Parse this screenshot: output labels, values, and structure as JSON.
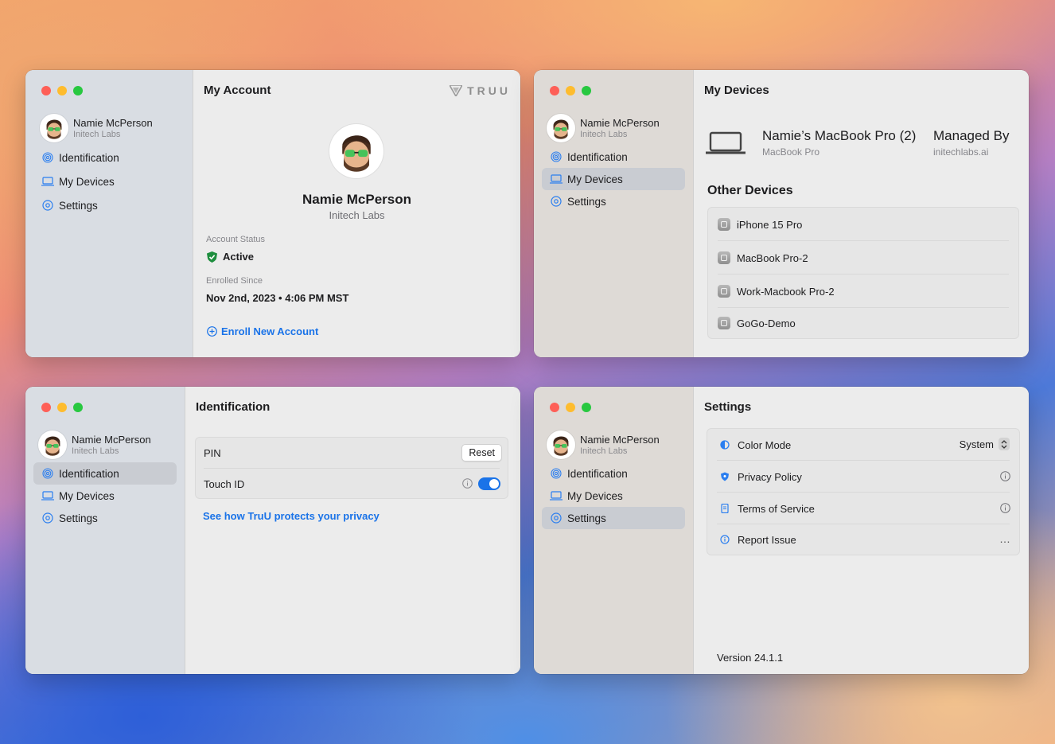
{
  "user": {
    "name": "Namie McPerson",
    "org": "Initech Labs"
  },
  "nav": {
    "identification": "Identification",
    "devices": "My Devices",
    "settings": "Settings"
  },
  "account": {
    "title": "My Account",
    "logo": "TRUU",
    "status_label": "Account Status",
    "status_value": "Active",
    "enrolled_label": "Enrolled Since",
    "enrolled_value": "Nov 2nd, 2023 • 4:06 PM MST",
    "enroll_link": "Enroll New Account"
  },
  "devices": {
    "title": "My Devices",
    "current_name": "Namie’s MacBook Pro (2)",
    "current_model": "MacBook Pro",
    "managed_label": "Managed By",
    "managed_value": "initechlabs.ai",
    "other_title": "Other Devices",
    "other": [
      "iPhone 15 Pro",
      "MacBook Pro-2",
      "Work-Macbook Pro-2",
      "GoGo-Demo"
    ]
  },
  "identification": {
    "title": "Identification",
    "pin_label": "PIN",
    "reset_label": "Reset",
    "touch_label": "Touch ID",
    "touch_enabled": true,
    "privacy_link": "See how TruU protects your privacy"
  },
  "settings": {
    "title": "Settings",
    "color_mode_label": "Color Mode",
    "color_mode_value": "System",
    "privacy": "Privacy Policy",
    "terms": "Terms of Service",
    "report": "Report Issue",
    "version": "Version 24.1.1"
  },
  "colors": {
    "accent": "#1a73e8",
    "active_green": "#1e8e3e"
  }
}
